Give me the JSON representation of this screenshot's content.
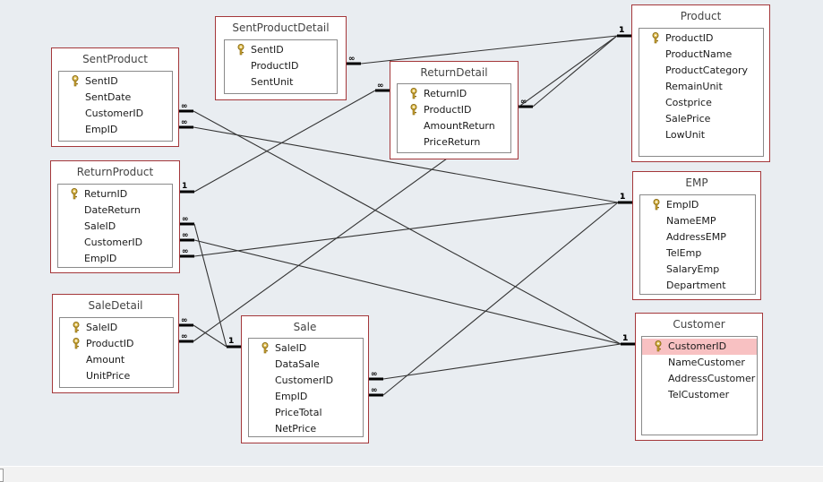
{
  "tables": [
    {
      "id": "SentProductDetail",
      "name": "SentProductDetail",
      "fields": [
        {
          "name": "SentID",
          "key": true
        },
        {
          "name": "ProductID",
          "key": false
        },
        {
          "name": "SentUnit",
          "key": false
        }
      ]
    },
    {
      "id": "SentProduct",
      "name": "SentProduct",
      "fields": [
        {
          "name": "SentID",
          "key": true
        },
        {
          "name": "SentDate",
          "key": false
        },
        {
          "name": "CustomerID",
          "key": false
        },
        {
          "name": "EmpID",
          "key": false
        }
      ]
    },
    {
      "id": "ReturnDetail",
      "name": "ReturnDetail",
      "fields": [
        {
          "name": "ReturnID",
          "key": true
        },
        {
          "name": "ProductID",
          "key": true
        },
        {
          "name": "AmountReturn",
          "key": false
        },
        {
          "name": "PriceReturn",
          "key": false
        }
      ]
    },
    {
      "id": "Product",
      "name": "Product",
      "fields": [
        {
          "name": "ProductID",
          "key": true
        },
        {
          "name": "ProductName",
          "key": false
        },
        {
          "name": "ProductCategory",
          "key": false
        },
        {
          "name": "RemainUnit",
          "key": false
        },
        {
          "name": "Costprice",
          "key": false
        },
        {
          "name": "SalePrice",
          "key": false
        },
        {
          "name": "LowUnit",
          "key": false
        }
      ]
    },
    {
      "id": "ReturnProduct",
      "name": "ReturnProduct",
      "fields": [
        {
          "name": "ReturnID",
          "key": true
        },
        {
          "name": "DateReturn",
          "key": false
        },
        {
          "name": "SaleID",
          "key": false
        },
        {
          "name": "CustomerID",
          "key": false
        },
        {
          "name": "EmpID",
          "key": false
        }
      ]
    },
    {
      "id": "EMP",
      "name": "EMP",
      "fields": [
        {
          "name": "EmpID",
          "key": true
        },
        {
          "name": "NameEMP",
          "key": false
        },
        {
          "name": "AddressEMP",
          "key": false
        },
        {
          "name": "TelEmp",
          "key": false
        },
        {
          "name": "SalaryEmp",
          "key": false
        },
        {
          "name": "Department",
          "key": false
        }
      ]
    },
    {
      "id": "SaleDetail",
      "name": "SaleDetail",
      "fields": [
        {
          "name": "SaleID",
          "key": true
        },
        {
          "name": "ProductID",
          "key": true
        },
        {
          "name": "Amount",
          "key": false
        },
        {
          "name": "UnitPrice",
          "key": false
        }
      ]
    },
    {
      "id": "Sale",
      "name": "Sale",
      "fields": [
        {
          "name": "SaleID",
          "key": true
        },
        {
          "name": "DataSale",
          "key": false
        },
        {
          "name": "CustomerID",
          "key": false
        },
        {
          "name": "EmpID",
          "key": false
        },
        {
          "name": "PriceTotal",
          "key": false
        },
        {
          "name": "NetPrice",
          "key": false
        }
      ]
    },
    {
      "id": "Customer",
      "name": "Customer",
      "selected_field": "CustomerID",
      "fields": [
        {
          "name": "CustomerID",
          "key": true
        },
        {
          "name": "NameCustomer",
          "key": false
        },
        {
          "name": "AddressCustomer",
          "key": false
        },
        {
          "name": "TelCustomer",
          "key": false
        }
      ]
    }
  ],
  "relationships": [
    {
      "from": "SentProductDetail.ProductID",
      "to": "Product.ProductID",
      "from_label": "∞",
      "to_label": "1"
    },
    {
      "from": "ReturnDetail.ProductID",
      "to": "Product.ProductID",
      "from_label": "∞",
      "to_label": "1"
    },
    {
      "from": "ReturnProduct.ReturnID",
      "to": "ReturnDetail.ReturnID",
      "from_label": "1",
      "to_label": "∞"
    },
    {
      "from": "SentProduct.CustomerID",
      "to": "Customer.CustomerID",
      "from_label": "∞",
      "to_label": "1"
    },
    {
      "from": "SentProduct.EmpID",
      "to": "EMP.EmpID",
      "from_label": "∞",
      "to_label": "1"
    },
    {
      "from": "ReturnProduct.SaleID",
      "to": "Sale.SaleID",
      "from_label": "∞",
      "to_label": "1"
    },
    {
      "from": "ReturnProduct.CustomerID",
      "to": "Customer.CustomerID",
      "from_label": "∞",
      "to_label": "1"
    },
    {
      "from": "ReturnProduct.EmpID",
      "to": "EMP.EmpID",
      "from_label": "∞",
      "to_label": "1"
    },
    {
      "from": "SaleDetail.SaleID",
      "to": "Sale.SaleID",
      "from_label": "∞",
      "to_label": "1"
    },
    {
      "from": "SaleDetail.ProductID",
      "to": "Product.ProductID",
      "from_label": "∞",
      "to_label": "1"
    },
    {
      "from": "Sale.CustomerID",
      "to": "Customer.CustomerID",
      "from_label": "∞",
      "to_label": "1"
    },
    {
      "from": "Sale.EmpID",
      "to": "EMP.EmpID",
      "from_label": "∞",
      "to_label": "1"
    }
  ],
  "colors": {
    "table_border": "#a4373a",
    "selected_field": "#f8c1c2",
    "canvas": "#e9edf1"
  }
}
